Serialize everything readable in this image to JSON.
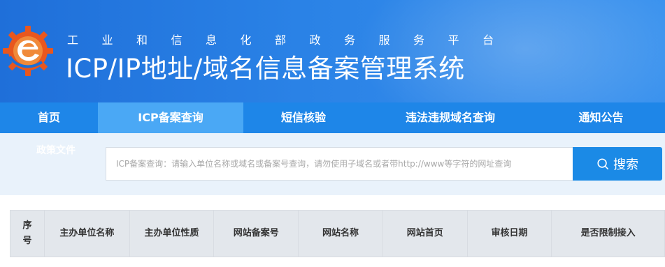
{
  "header": {
    "platform_name": "工业和信息化部政务服务平台",
    "system_name": "ICP/IP地址/域名信息备案管理系统",
    "logo_icon": "miit-logo-icon"
  },
  "nav": {
    "items": [
      {
        "label": "首页",
        "active": false
      },
      {
        "label": "ICP备案查询",
        "active": true
      },
      {
        "label": "短信核验",
        "active": false
      },
      {
        "label": "违法违规域名查询",
        "active": false
      },
      {
        "label": "通知公告",
        "active": false
      }
    ],
    "policy_link": "政策文件"
  },
  "search": {
    "placeholder": "ICP备案查询：请输入单位名称或域名或备案号查询，请勿使用子域名或者带http://www等字符的网址查询",
    "value": "",
    "button_label": "搜索",
    "button_icon": "search-icon"
  },
  "table": {
    "columns": [
      "序号",
      "主办单位名称",
      "主办单位性质",
      "网站备案号",
      "网站名称",
      "网站首页",
      "审核日期",
      "是否限制接入"
    ]
  },
  "colors": {
    "banner": "#2a82e6",
    "nav": "#1e86e8",
    "nav_active": "#4aa8f5",
    "search_bg": "#e9f2fb",
    "button": "#1b8ae6",
    "table_header": "#e3e7ec"
  }
}
